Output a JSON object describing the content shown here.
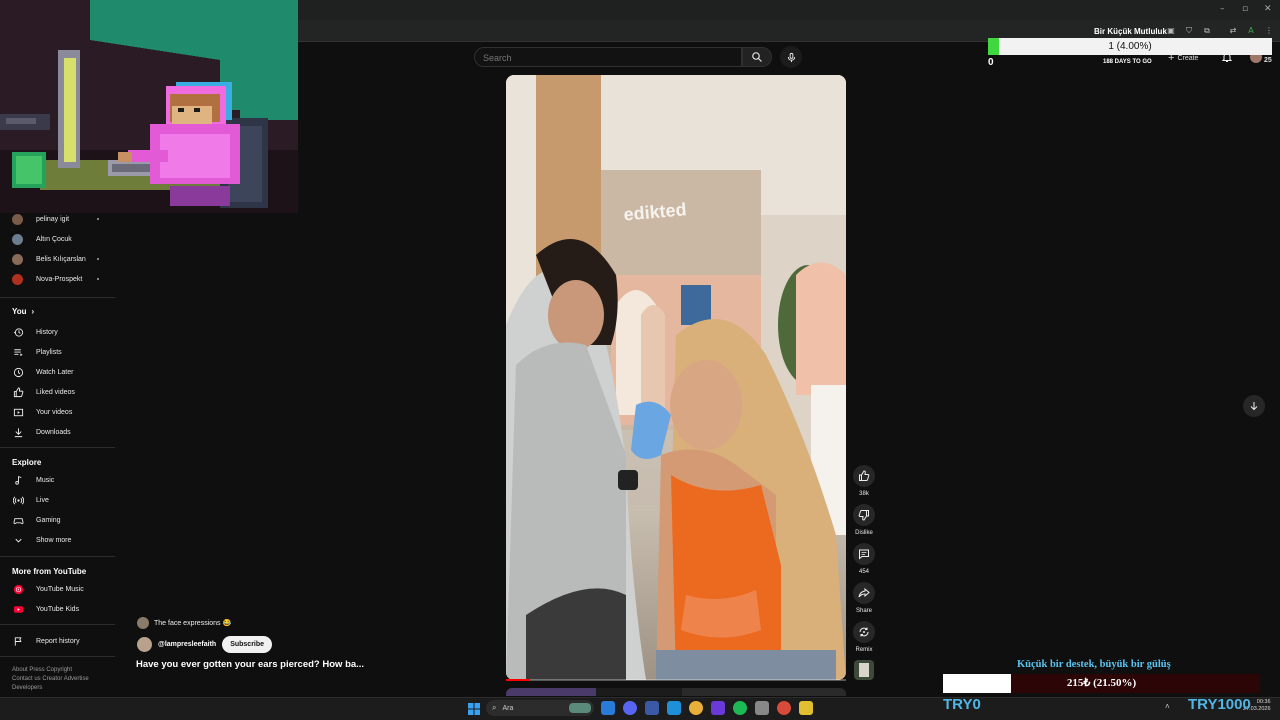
{
  "header": {
    "search_placeholder": "Search",
    "create_label": "Create",
    "notification_count": "25"
  },
  "goal_overlay": {
    "title": "Bir Küçük Mutluluk",
    "progress_text": "1 (4.00%)",
    "progress_fraction": 0.04,
    "current": "0",
    "days_left": "188 DAYS TO GO"
  },
  "sidebar": {
    "subscriptions": [
      {
        "label": "pelinay igit",
        "avatar_color": "#7a5b4a",
        "dot": true
      },
      {
        "label": "Altın Çocuk",
        "avatar_color": "#6b7d8f",
        "dot": false
      },
      {
        "label": "Belis Kılıçarslan",
        "avatar_color": "#8a6a58",
        "dot": true
      },
      {
        "label": "Nova-Prospekt",
        "avatar_color": "#b03020",
        "dot": true
      }
    ],
    "you_heading": "You",
    "you_items": [
      {
        "label": "History",
        "icon": "history-icon"
      },
      {
        "label": "Playlists",
        "icon": "playlists-icon"
      },
      {
        "label": "Watch Later",
        "icon": "clock-icon"
      },
      {
        "label": "Liked videos",
        "icon": "thumbs-up-icon"
      },
      {
        "label": "Your videos",
        "icon": "play-box-icon"
      },
      {
        "label": "Downloads",
        "icon": "download-icon"
      }
    ],
    "explore_heading": "Explore",
    "explore_items": [
      {
        "label": "Music",
        "icon": "music-note-icon"
      },
      {
        "label": "Live",
        "icon": "live-icon"
      },
      {
        "label": "Gaming",
        "icon": "gamepad-icon"
      },
      {
        "label": "Show more",
        "icon": "chevron-down-icon"
      }
    ],
    "more_heading": "More from YouTube",
    "more_items": [
      {
        "label": "YouTube Music",
        "icon": "youtube-music-icon"
      },
      {
        "label": "YouTube Kids",
        "icon": "youtube-kids-icon"
      }
    ],
    "report_label": "Report history",
    "footer_line1": "About   Press   Copyright",
    "footer_line2": "Contact us   Creator   Advertise",
    "footer_line3": "Developers"
  },
  "video": {
    "comment_preview": "The face expressions 😂",
    "channel": "@lampresleefaith",
    "subscribe_label": "Subscribe",
    "title": "Have you ever gotten your ears pierced? How ba...",
    "store_sign": "edikted",
    "progress_fraction": 0.07
  },
  "actions": {
    "likes": "38k",
    "dislike_label": "Dislike",
    "comments": "454",
    "share_label": "Share",
    "remix_label": "Remix"
  },
  "donation": {
    "title": "Küçük bir destek, büyük bir gülüş",
    "progress_text": "215₺ (21.50%)",
    "progress_fraction": 0.215,
    "left_label": "TRY0",
    "right_label": "TRY1000"
  },
  "taskbar": {
    "search_label": "Ara",
    "time": "00:36",
    "date": "27.03.2026"
  }
}
